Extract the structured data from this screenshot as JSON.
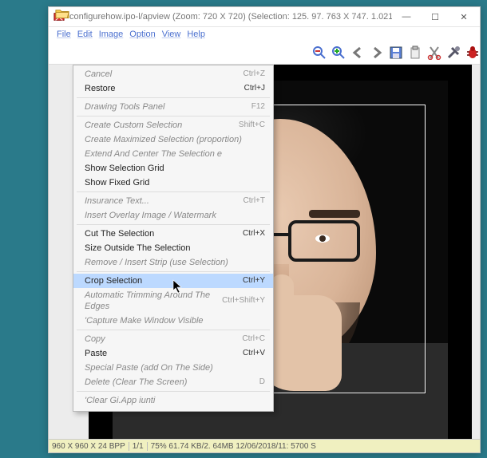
{
  "window": {
    "title": "configurehow.ipo-l/apview (Zoom: 720 X 720) (Selection: 125. 97. 763 X 747. 1.021)",
    "controls": {
      "min": "—",
      "max": "☐",
      "close": "✕"
    }
  },
  "menubar": [
    "File",
    "Edit",
    "Image",
    "Option",
    "View",
    "Help"
  ],
  "toolbar_right": [
    "zoom-out",
    "zoom-in",
    "arrow-left",
    "arrow-right",
    "save",
    "clipboard",
    "scissors",
    "tools",
    "bug"
  ],
  "folder_icon": "open-folder",
  "context_menu": [
    {
      "label": "Cancel",
      "shortcut": "Ctrl+Z",
      "active": false
    },
    {
      "label": "Restore",
      "shortcut": "Ctrl+J",
      "active": true
    },
    {
      "sep": true
    },
    {
      "label": "Drawing Tools Panel",
      "shortcut": "F12",
      "active": false
    },
    {
      "sep": true
    },
    {
      "label": "Create Custom Selection",
      "shortcut": "Shift+C",
      "active": false
    },
    {
      "label": "Create Maximized Selection (proportion)",
      "shortcut": "",
      "active": false
    },
    {
      "label": "Extend And Center The Selection e",
      "shortcut": "",
      "active": false
    },
    {
      "label": "Show Selection Grid",
      "shortcut": "",
      "active": true
    },
    {
      "label": "Show Fixed Grid",
      "shortcut": "",
      "active": true
    },
    {
      "sep": true
    },
    {
      "label": "Insurance Text...",
      "shortcut": "Ctrl+T",
      "active": false
    },
    {
      "label": "Insert Overlay Image / Watermark",
      "shortcut": "",
      "active": false
    },
    {
      "sep": true
    },
    {
      "label": "Cut The Selection",
      "shortcut": "Ctrl+X",
      "active": true
    },
    {
      "label": "Size Outside The Selection",
      "shortcut": "",
      "active": true
    },
    {
      "label": "Remove / Insert Strip (use Selection)",
      "shortcut": "",
      "active": false
    },
    {
      "sep": true
    },
    {
      "label": "Crop Selection",
      "shortcut": "Ctrl+Y",
      "active": true,
      "hover": true
    },
    {
      "label": "Automatic Trimming Around The Edges",
      "shortcut": "Ctrl+Shift+Y",
      "active": false
    },
    {
      "label": "'Capture Make Window Visible",
      "shortcut": "",
      "active": false
    },
    {
      "sep": true
    },
    {
      "label": "Copy",
      "shortcut": "Ctrl+C",
      "active": false
    },
    {
      "label": "Paste",
      "shortcut": "Ctrl+V",
      "active": true
    },
    {
      "label": "Special Paste (add On The Side)",
      "shortcut": "",
      "active": false
    },
    {
      "label": "Delete (Clear The Screen)",
      "shortcut": "D",
      "active": false
    },
    {
      "sep": true
    },
    {
      "label": "'Clear Gi.App  iunti",
      "shortcut": "",
      "active": false
    }
  ],
  "statusbar": {
    "dims": "960 X 960 X 24 BPP",
    "page": "1/1",
    "zoom_size_date": "75% 61.74 KB/2. 64MB 12/06/2018/11: 5700 S"
  }
}
